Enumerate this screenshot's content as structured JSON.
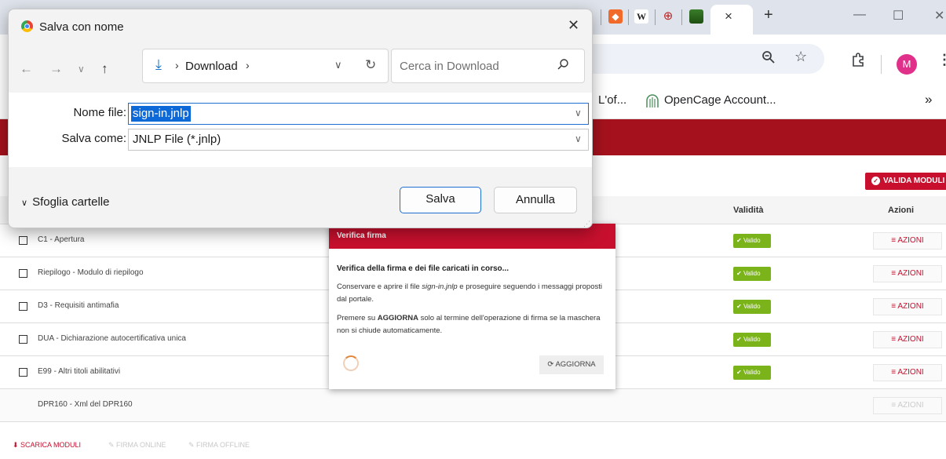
{
  "browser": {
    "tab_icons": [
      "brave-shield-icon",
      "wikipedia-icon",
      "crest-icon",
      "grass-icon"
    ],
    "wiki_glyph": "W",
    "active_tab_close": "×",
    "new_tab": "+",
    "avatar_initial": "M",
    "bookmarks": [
      "L'of...",
      "OpenCage Account..."
    ],
    "bookmarks_more": "»"
  },
  "save_dialog": {
    "title": "Salva con nome",
    "path_folder": "Download",
    "search_placeholder": "Cerca in Download",
    "filename_label": "Nome file:",
    "filename_value": "sign-in.jnlp",
    "savetype_label": "Salva come:",
    "savetype_value": "JNLP File (*.jnlp)",
    "browse_folders": "Sfoglia cartelle",
    "save_button": "Salva",
    "cancel_button": "Annulla"
  },
  "page": {
    "valida_button": "VALIDA MODULI",
    "columns": {
      "validita": "Validità",
      "azioni": "Azioni"
    },
    "rows": [
      {
        "label": "C1 - Apertura",
        "status": "Valido",
        "action": "AZIONI"
      },
      {
        "label": "Riepilogo - Modulo di riepilogo",
        "status": "Valido",
        "action": "AZIONI"
      },
      {
        "label": "D3 - Requisiti antimafia",
        "status": "Valido",
        "action": "AZIONI"
      },
      {
        "label": "DUA - Dichiarazione autocertificativa unica",
        "status": "Valido",
        "action": "AZIONI"
      },
      {
        "label": "E99 - Altri titoli abilitativi",
        "status": "Valido",
        "action": "AZIONI"
      },
      {
        "label": "DPR160 - Xml del DPR160",
        "status": "",
        "action": "AZIONI"
      }
    ],
    "footer": {
      "download": "SCARICA MODULI",
      "sign_online": "FIRMA ONLINE",
      "sign_offline": "FIRMA OFFLINE"
    },
    "colors": {
      "brand_red": "#c8102e",
      "band_red": "#a5121d",
      "valid_green": "#7bb31a"
    }
  },
  "verify_modal": {
    "title": "Verifica firma",
    "heading": "Verifica della firma e dei file caricati in corso...",
    "p1_before": "Conservare e aprire il file ",
    "p1_file": "sign-in.jnlp",
    "p1_after": " e proseguire seguendo i messaggi proposti dal portale.",
    "p2_before": "Premere su ",
    "p2_bold": "AGGIORNA",
    "p2_after": " solo al termine dell'operazione di firma se la maschera non si chiude automaticamente.",
    "refresh_button": "AGGIORNA"
  }
}
